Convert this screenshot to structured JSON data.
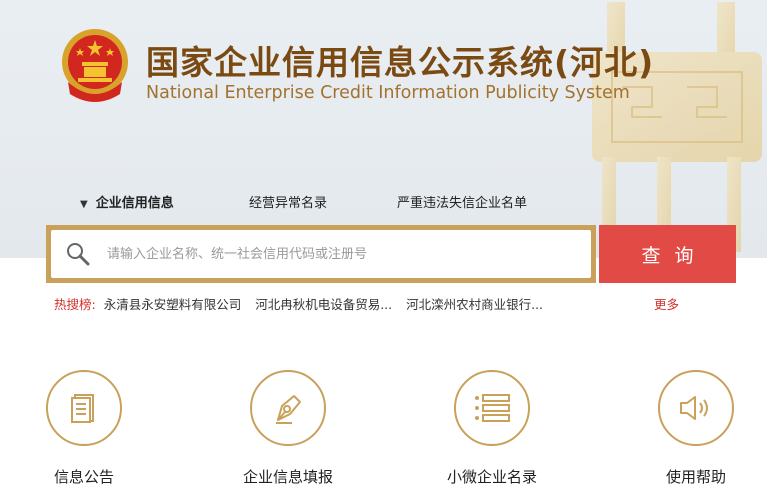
{
  "header": {
    "title_cn": "国家企业信用信息公示系统(河北)",
    "title_en": "National Enterprise Credit Information Publicity System"
  },
  "tabs": [
    {
      "label": "企业信用信息",
      "active": true
    },
    {
      "label": "经营异常名录",
      "active": false
    },
    {
      "label": "严重违法失信企业名单",
      "active": false
    }
  ],
  "search": {
    "placeholder": "请输入企业名称、统一社会信用代码或注册号",
    "button_label": "查询"
  },
  "hot_search": {
    "label": "热搜榜:",
    "items": [
      "永清县永安塑料有限公司",
      "河北冉秋机电设备贸易...",
      "河北滦州农村商业银行..."
    ],
    "more_label": "更多"
  },
  "features": [
    {
      "label": "信息公告",
      "icon": "document-icon"
    },
    {
      "label": "企业信息填报",
      "icon": "pen-nib-icon"
    },
    {
      "label": "小微企业名录",
      "icon": "list-icon"
    },
    {
      "label": "使用帮助",
      "icon": "speaker-icon"
    }
  ],
  "colors": {
    "accent_gold": "#c9a15a",
    "title_brown": "#7a4a12",
    "button_red": "#e24a45",
    "hot_red": "#d2302a"
  }
}
